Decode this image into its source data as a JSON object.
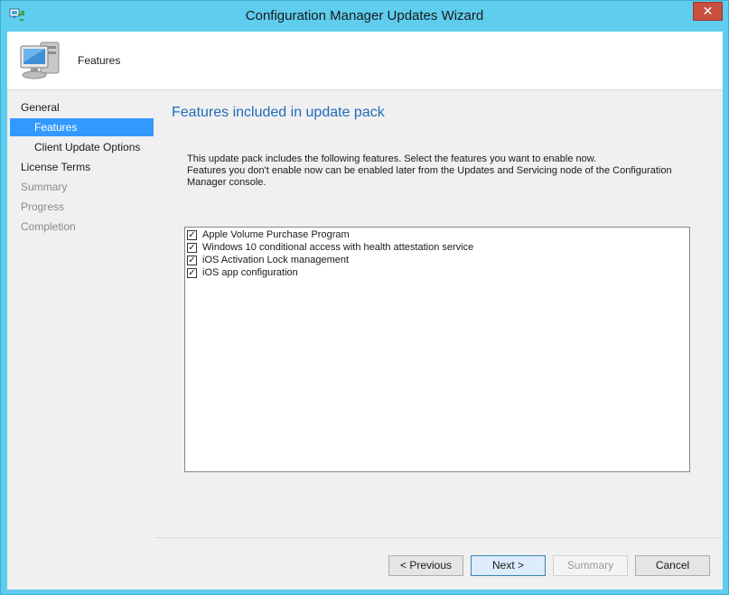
{
  "window": {
    "title": "Configuration Manager Updates Wizard",
    "close_label": "✕",
    "accent_color": "#5ecdee"
  },
  "header": {
    "title": "Features",
    "icon": "computer-icon"
  },
  "nav": {
    "items": [
      {
        "label": "General",
        "level": 0,
        "state": "normal"
      },
      {
        "label": "Features",
        "level": 1,
        "state": "selected"
      },
      {
        "label": "Client Update Options",
        "level": 1,
        "state": "normal"
      },
      {
        "label": "License Terms",
        "level": 0,
        "state": "normal"
      },
      {
        "label": "Summary",
        "level": 0,
        "state": "disabled"
      },
      {
        "label": "Progress",
        "level": 0,
        "state": "disabled"
      },
      {
        "label": "Completion",
        "level": 0,
        "state": "disabled"
      }
    ]
  },
  "main": {
    "heading": "Features included in update pack",
    "description_line1": "This update pack includes the following features. Select the features you want to enable now.",
    "description_line2": "Features you don't enable now can be enabled later from the Updates and Servicing node of the Configuration Manager console.",
    "features": [
      {
        "label": "Apple Volume Purchase Program",
        "checked": true
      },
      {
        "label": "Windows 10 conditional access with health attestation service",
        "checked": true
      },
      {
        "label": "iOS Activation Lock management",
        "checked": true
      },
      {
        "label": "iOS app configuration",
        "checked": true
      }
    ]
  },
  "buttons": {
    "previous": "< Previous",
    "next": "Next >",
    "summary": "Summary",
    "cancel": "Cancel"
  }
}
